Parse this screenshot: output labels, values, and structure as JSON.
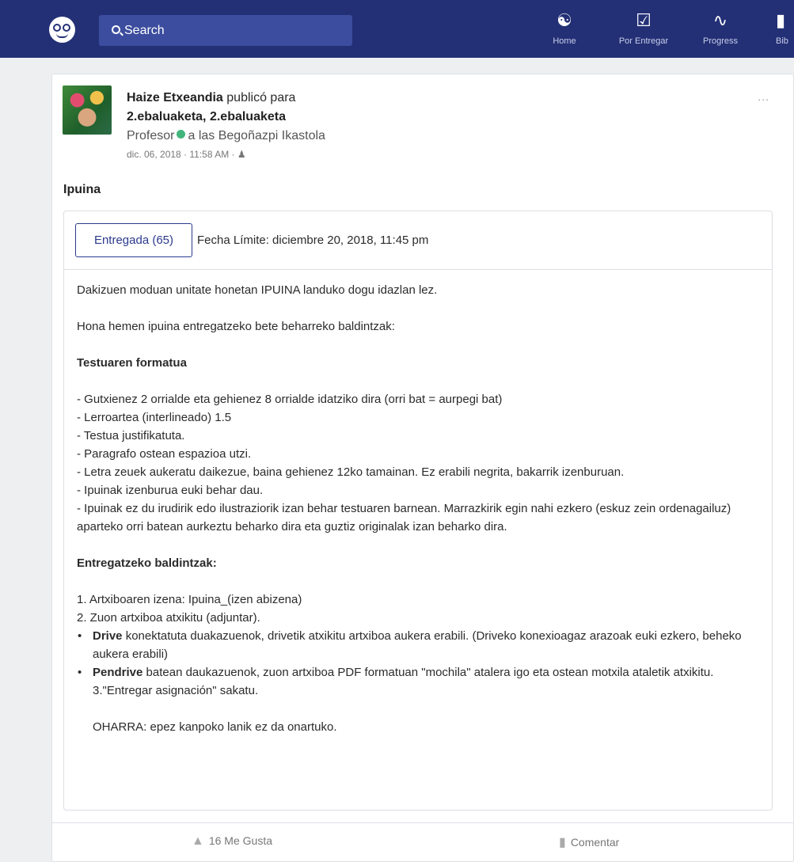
{
  "topbar": {
    "search_placeholder": "Search",
    "nav": [
      {
        "label": "Home",
        "icon": "home-icon"
      },
      {
        "label": "Por Entregar",
        "icon": "calendar-check-icon"
      },
      {
        "label": "Progress",
        "icon": "pulse-icon"
      },
      {
        "label": "Bib",
        "icon": "backpack-icon"
      }
    ]
  },
  "post": {
    "author": "Haize Etxeandia",
    "posted_for": "publicó para",
    "groups": "2.ebaluaketa,  2.ebaluaketa",
    "role": "Profesor",
    "school": "a las Begoñazpi Ikastola",
    "date": "dic. 06, 2018 · 11:58 AM ·",
    "more": "...",
    "title": "Ipuina"
  },
  "assignment": {
    "turned_in_label": "Entregada (65)",
    "due_label": "Fecha Límite: diciembre 20, 2018, 11:45 pm",
    "p1": "Dakizuen moduan unitate honetan IPUINA landuko dogu idazlan lez.",
    "p2": "Hona hemen ipuina entregatzeko bete beharreko baldintzak:",
    "h1": "Testuaren formatua",
    "format_lines": [
      "- Gutxienez 2 orrialde eta gehienez 8 orrialde idatziko dira (orri bat = aurpegi bat)",
      "- Lerroartea (interlineado) 1.5",
      "- Testua justifikatuta.",
      "- Paragrafo ostean espazioa utzi.",
      "- Letra zeuek aukeratu daikezue, baina gehienez 12ko tamainan. Ez erabili negrita, bakarrik izenburuan.",
      "- Ipuinak izenburua euki behar dau.",
      "- Ipuinak ez du irudirik edo ilustraziorik izan behar testuaren barnean. Marrazkirik egin nahi ezkero (eskuz zein ordenagailuz) aparteko orri batean aurkeztu beharko dira eta guztiz originalak izan beharko dira."
    ],
    "h2": "Entregatzeko baldintzak:",
    "step1": "1. Artxiboaren izena: Ipuina_(izen abizena)",
    "step2": "2. Zuon artxiboa atxikitu (adjuntar).",
    "drive_bold": "Drive",
    "drive_text": " konektatuta duakazuenok, drivetik atxikitu artxiboa aukera erabili. (Driveko konexioagaz arazoak euki ezkero, beheko aukera erabili)",
    "pendrive_bold": "Pendrive",
    "pendrive_text": " batean daukazuenok, zuon artxiboa PDF formatuan \"mochila\" atalera igo eta ostean motxila ataletik atxikitu.",
    "step3": "3.\"Entregar asignación\" sakatu.",
    "note": "OHARRA: epez kanpoko lanik ez da onartuko."
  },
  "footer": {
    "likes": "16 Me Gusta",
    "comment": "Comentar"
  }
}
